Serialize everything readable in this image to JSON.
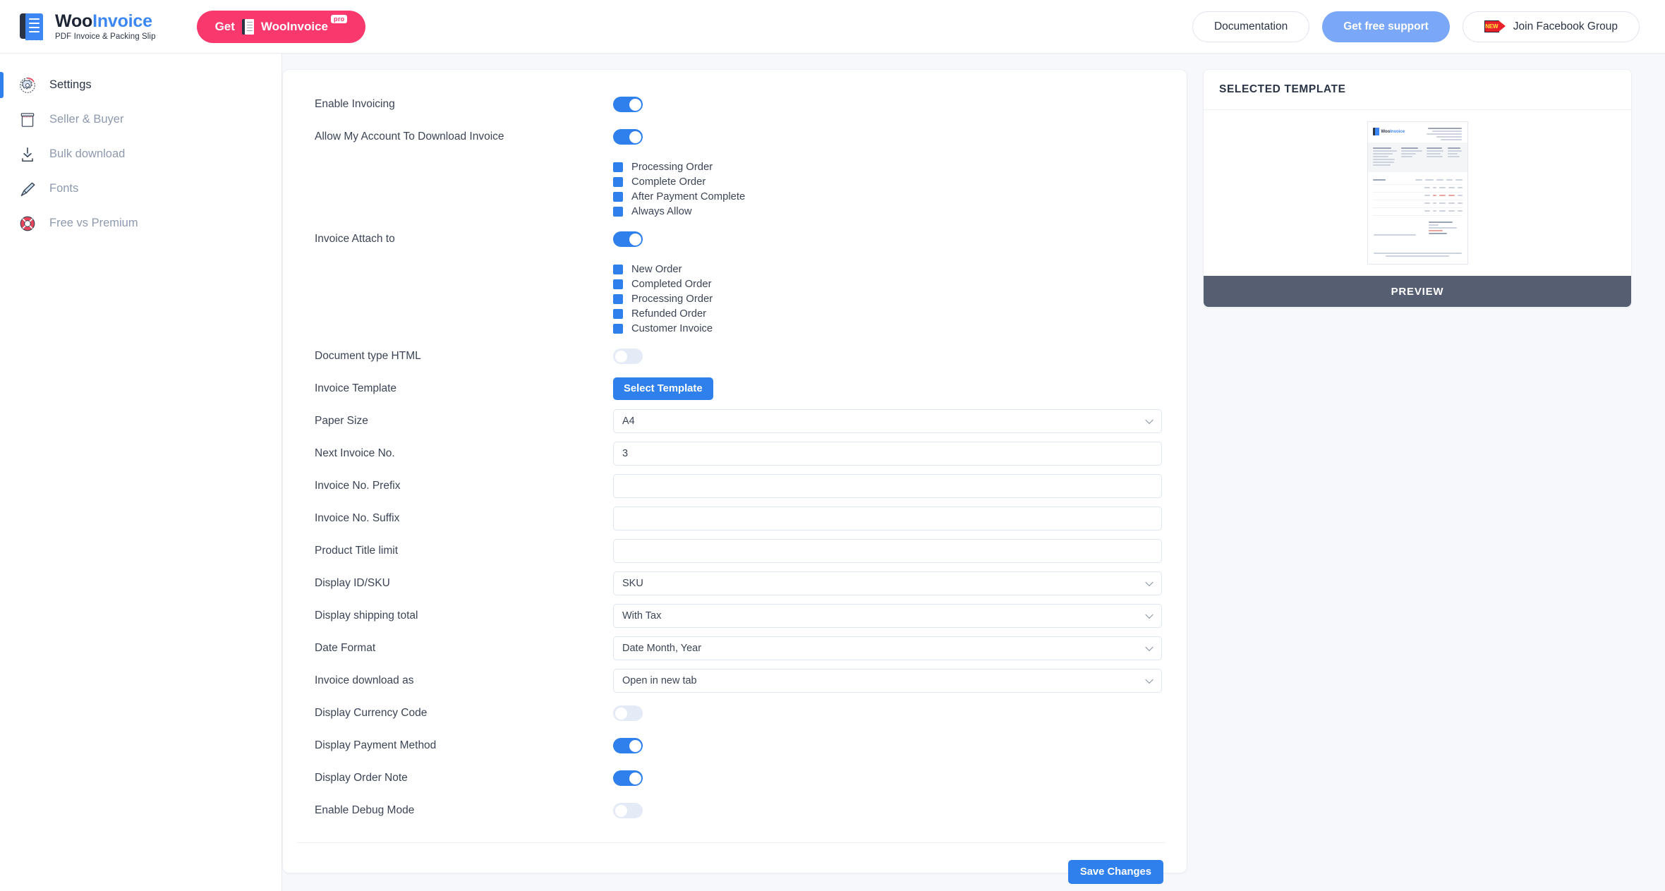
{
  "brand": {
    "name_1": "Woo",
    "name_2": "Invoice",
    "tagline": "PDF Invoice & Packing Slip",
    "logo_icon": "wooinvoice-logo-icon"
  },
  "header": {
    "get_pro_prefix": "Get",
    "get_pro_name": "WooInvoice",
    "get_pro_badge": "pro",
    "documentation_label": "Documentation",
    "support_label": "Get free support",
    "facebook_label": "Join Facebook Group",
    "facebook_badge": "NEW",
    "accent_pink": "#f9386e",
    "accent_blue": "#7aa7f7"
  },
  "sidebar": {
    "items": [
      {
        "label": "Settings",
        "icon": "gear-icon",
        "active": true
      },
      {
        "label": "Seller & Buyer",
        "icon": "store-icon",
        "active": false
      },
      {
        "label": "Bulk download",
        "icon": "download-icon",
        "active": false
      },
      {
        "label": "Fonts",
        "icon": "pen-icon",
        "active": false
      },
      {
        "label": "Free vs Premium",
        "icon": "lifebuoy-icon",
        "active": false
      }
    ]
  },
  "settings": {
    "enable_invoicing": {
      "label": "Enable Invoicing",
      "state": "on"
    },
    "allow_download": {
      "label": "Allow My Account To Download Invoice",
      "state": "on"
    },
    "allow_download_options": [
      "Processing Order",
      "Complete Order",
      "After Payment Complete",
      "Always Allow"
    ],
    "invoice_attach": {
      "label": "Invoice Attach to",
      "state": "on"
    },
    "invoice_attach_options": [
      "New Order",
      "Completed Order",
      "Processing Order",
      "Refunded Order",
      "Customer Invoice"
    ],
    "document_type_html": {
      "label": "Document type HTML",
      "state": "off"
    },
    "invoice_template": {
      "label": "Invoice Template",
      "button": "Select Template"
    },
    "paper_size": {
      "label": "Paper Size",
      "value": "A4"
    },
    "next_invoice_no": {
      "label": "Next Invoice No.",
      "value": "3"
    },
    "invoice_prefix": {
      "label": "Invoice No. Prefix",
      "value": ""
    },
    "invoice_suffix": {
      "label": "Invoice No. Suffix",
      "value": ""
    },
    "product_title_limit": {
      "label": "Product Title limit",
      "value": ""
    },
    "display_id_sku": {
      "label": "Display ID/SKU",
      "value": "SKU"
    },
    "display_shipping_total": {
      "label": "Display shipping total",
      "value": "With Tax"
    },
    "date_format": {
      "label": "Date Format",
      "value": "Date Month, Year"
    },
    "invoice_download_as": {
      "label": "Invoice download as",
      "value": "Open in new tab"
    },
    "display_currency_code": {
      "label": "Display Currency Code",
      "state": "off"
    },
    "display_payment_method": {
      "label": "Display Payment Method",
      "state": "on"
    },
    "display_order_note": {
      "label": "Display Order Note",
      "state": "on"
    },
    "enable_debug_mode": {
      "label": "Enable Debug Mode",
      "state": "off"
    },
    "save_label": "Save Changes"
  },
  "template_panel": {
    "title": "SELECTED TEMPLATE",
    "preview_label": "PREVIEW",
    "thumb_logo_1": "Woo",
    "thumb_logo_2": "Invoice"
  },
  "colors": {
    "primary_blue": "#2f80ed",
    "toggle_off": "#e4eaf6",
    "preview_bar": "#565f71",
    "page_bg": "#f6f8fb"
  }
}
